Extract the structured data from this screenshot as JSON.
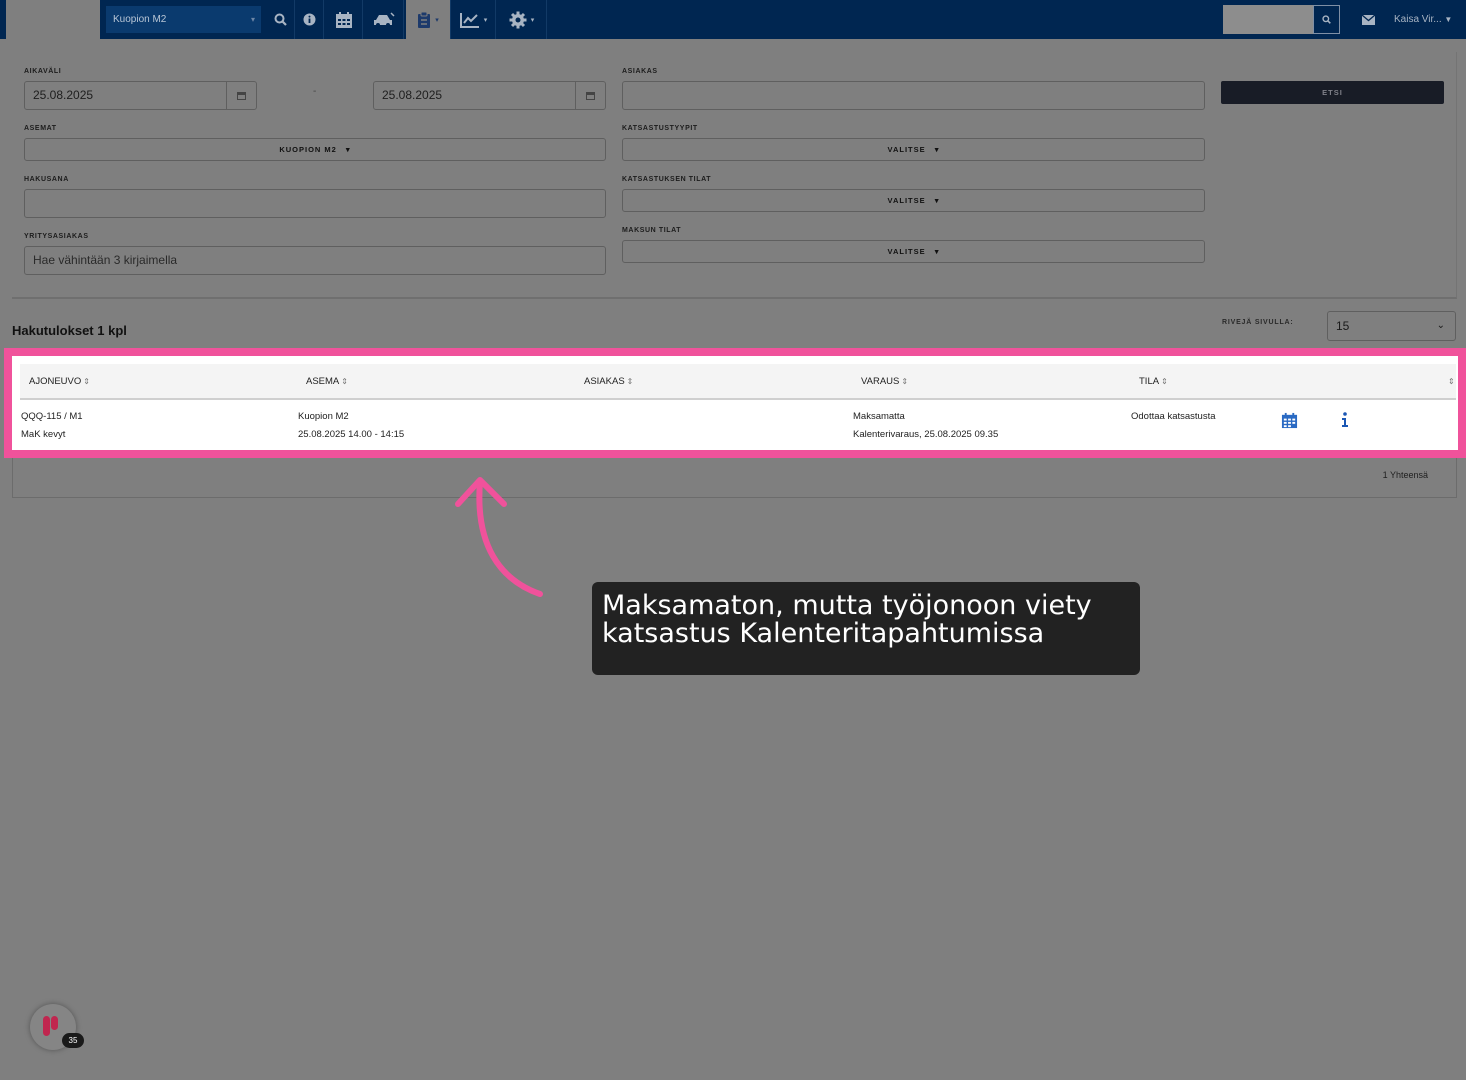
{
  "topbar": {
    "station": "Kuopion M2",
    "user": "Kaisa Vir...",
    "icons": [
      "search-icon",
      "info-icon",
      "calendar-icon",
      "car-icon",
      "clipboard-icon",
      "chart-icon",
      "gear-icon",
      "mail-icon"
    ]
  },
  "filters": {
    "aikavali_label": "AIKAVÄLI",
    "date_from": "25.08.2025",
    "date_separator": "-",
    "date_to": "25.08.2025",
    "asiakas_label": "ASIAKAS",
    "search_button": "ETSI",
    "asemat_label": "ASEMAT",
    "asemat_value": "KUOPION M2",
    "katsastustyypit_label": "KATSASTUSTYYPIT",
    "katsastustyypit_value": "VALITSE",
    "hakusana_label": "HAKUSANA",
    "katsastuksen_tilat_label": "KATSASTUKSEN TILAT",
    "katsastuksen_tilat_value": "VALITSE",
    "yritysasiakas_label": "YRITYSASIAKAS",
    "yritysasiakas_placeholder": "Hae vähintään 3 kirjaimella",
    "maksun_tilat_label": "MAKSUN TILAT",
    "maksun_tilat_value": "VALITSE"
  },
  "results": {
    "title": "Hakutulokset 1 kpl",
    "rows_label": "RIVEJÄ SIVULLA:",
    "rows_value": "15",
    "total": "1 Yhteensä"
  },
  "table": {
    "headers": [
      "AJONEUVO",
      "ASEMA",
      "ASIAKAS",
      "VARAUS",
      "TILA"
    ],
    "rows": [
      {
        "ajoneuvo_1": "QQQ-115 / M1",
        "ajoneuvo_2": "MaK kevyt",
        "asema_1": "Kuopion M2",
        "asema_2": "25.08.2025 14.00 - 14:15",
        "asiakas": "",
        "varaus_1": "Maksamatta",
        "varaus_2": "Kalenterivaraus, 25.08.2025 09.35",
        "tila": "Odottaa katsastusta"
      }
    ]
  },
  "annotation": {
    "text_line1": "Maksamaton, mutta työjonoon viety",
    "text_line2": "katsastus Kalenteritapahtumissa",
    "highlight_color": "#f0529b"
  },
  "widget": {
    "badge": "35"
  }
}
